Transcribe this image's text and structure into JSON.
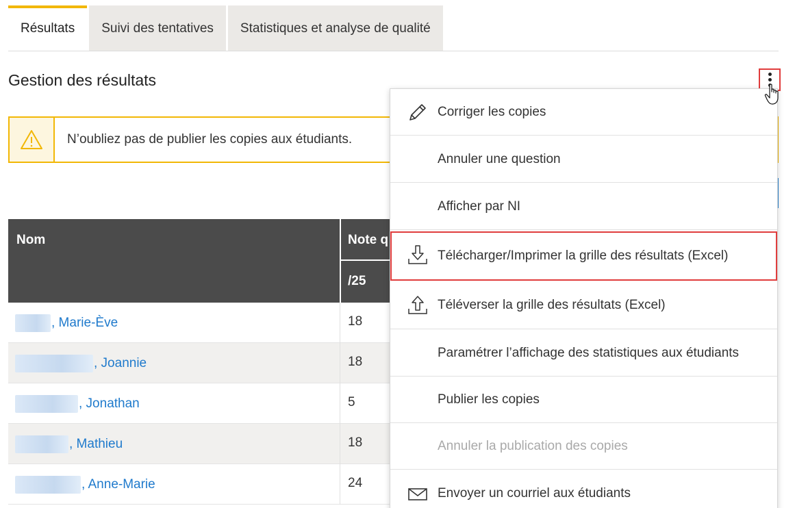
{
  "tabs": [
    {
      "label": "Résultats",
      "active": true
    },
    {
      "label": "Suivi des tentatives",
      "active": false
    },
    {
      "label": "Statistiques et analyse de qualité",
      "active": false
    }
  ],
  "page_title": "Gestion des résultats",
  "warning": {
    "icon": "warning-triangle-icon",
    "text": "N’oubliez pas de publier les copies aux étudiants."
  },
  "table": {
    "headers": {
      "name": "Nom",
      "note": "Note q",
      "note_sub": "/25"
    },
    "rows": [
      {
        "name": ", Marie-Ève",
        "score": "18"
      },
      {
        "name": ", Joannie",
        "score": "18"
      },
      {
        "name": ", Jonathan",
        "score": "5"
      },
      {
        "name": ", Mathieu",
        "score": "18"
      },
      {
        "name": ", Anne-Marie",
        "score": "24"
      }
    ]
  },
  "menu": {
    "items": [
      {
        "label": "Corriger les copies",
        "icon": "pencil-icon"
      },
      {
        "label": "Annuler une question",
        "icon": ""
      },
      {
        "label": "Afficher par NI",
        "icon": ""
      },
      {
        "label": "Télécharger/Imprimer la grille des résultats (Excel)",
        "icon": "download-icon",
        "highlighted": true
      },
      {
        "label": "Téléverser la grille des résultats (Excel)",
        "icon": "upload-icon"
      },
      {
        "label": "Paramétrer l’affichage des statistiques aux étudiants",
        "icon": ""
      },
      {
        "label": "Publier les copies",
        "icon": ""
      },
      {
        "label": "Annuler la publication des copies",
        "icon": "",
        "disabled": true
      },
      {
        "label": "Envoyer un courriel aux étudiants",
        "icon": "envelope-icon"
      }
    ]
  },
  "colors": {
    "accent": "#f2b705",
    "link": "#1f7acc",
    "header": "#4b4b4b",
    "highlight": "#e03c3c"
  }
}
